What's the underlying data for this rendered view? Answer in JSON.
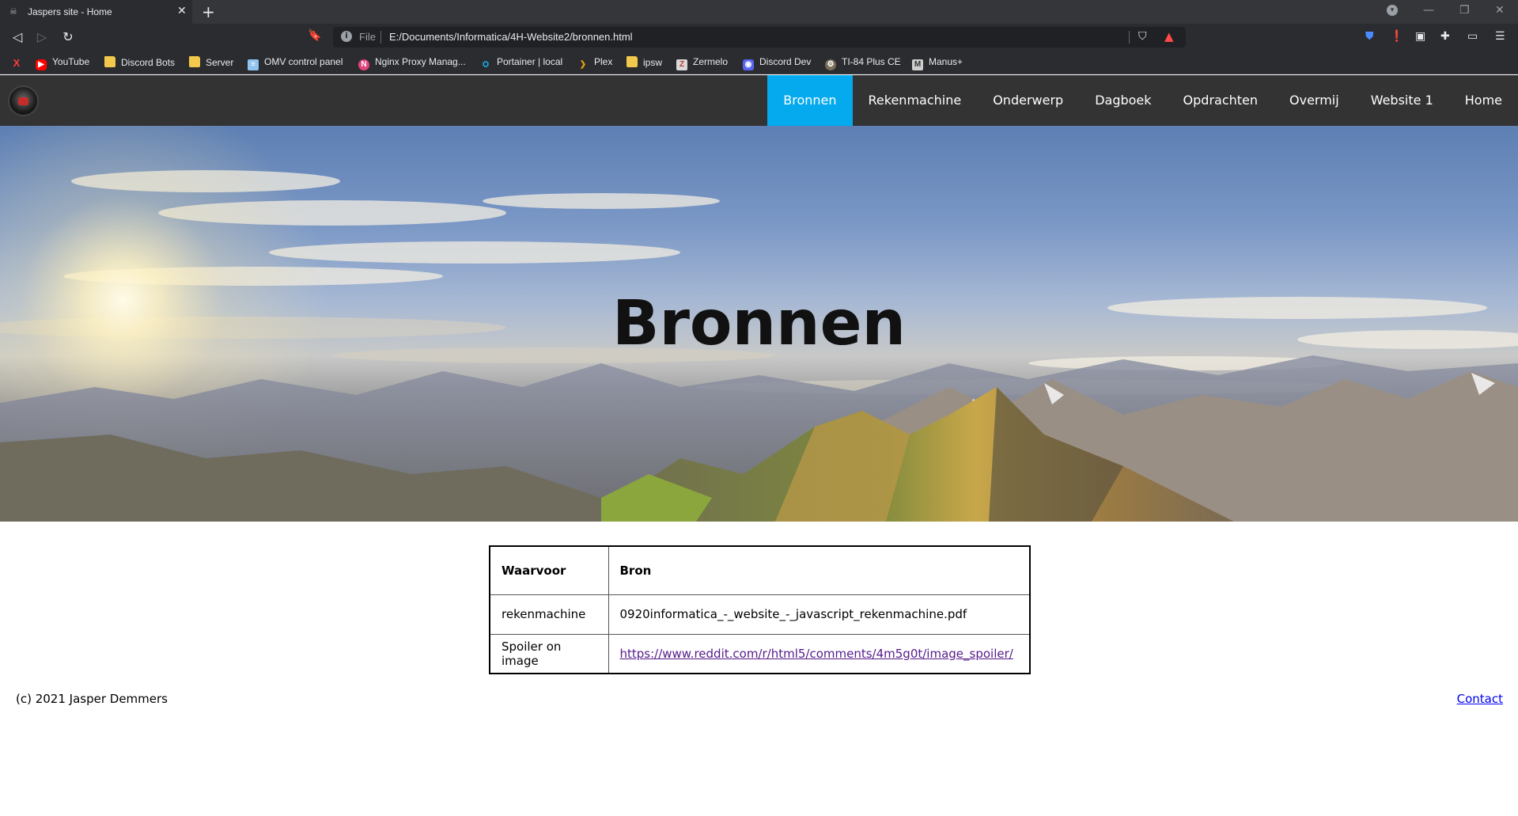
{
  "browser": {
    "tab_title": "Jaspers site - Home",
    "address_scheme": "File",
    "address_url": "E:/Documents/Informatica/4H-Website2/bronnen.html",
    "bookmarks": [
      {
        "label": "",
        "icon": "x-icon"
      },
      {
        "label": "YouTube",
        "icon": "youtube-icon"
      },
      {
        "label": "Discord Bots",
        "icon": "folder-icon"
      },
      {
        "label": "Server",
        "icon": "folder-icon"
      },
      {
        "label": "OMV control panel",
        "icon": "omv-icon"
      },
      {
        "label": "Nginx Proxy Manag...",
        "icon": "nginx-icon"
      },
      {
        "label": "Portainer | local",
        "icon": "portainer-icon"
      },
      {
        "label": "Plex",
        "icon": "plex-icon"
      },
      {
        "label": "ipsw",
        "icon": "folder-icon"
      },
      {
        "label": "Zermelo",
        "icon": "zermelo-icon"
      },
      {
        "label": "Discord Dev",
        "icon": "discord-icon"
      },
      {
        "label": "TI-84 Plus CE",
        "icon": "ti84-icon"
      },
      {
        "label": "Manus+",
        "icon": "manus-icon"
      }
    ]
  },
  "nav": {
    "items": [
      {
        "label": "Bronnen",
        "active": true
      },
      {
        "label": "Rekenmachine",
        "active": false
      },
      {
        "label": "Onderwerp",
        "active": false
      },
      {
        "label": "Dagboek",
        "active": false
      },
      {
        "label": "Opdrachten",
        "active": false
      },
      {
        "label": "Overmij",
        "active": false
      },
      {
        "label": "Website 1",
        "active": false
      },
      {
        "label": "Home",
        "active": false
      }
    ],
    "active_color": "#04AAED"
  },
  "hero": {
    "title": "Bronnen"
  },
  "sources_table": {
    "headers": [
      "Waarvoor",
      "Bron"
    ],
    "rows": [
      {
        "purpose": "rekenmachine",
        "source": "0920informatica_-_website_-_javascript_rekenmachine.pdf",
        "is_link": false
      },
      {
        "purpose": "Spoiler on image",
        "source": "https://www.reddit.com/r/html5/comments/4m5g0t/image_spoiler/",
        "is_link": true
      }
    ]
  },
  "footer": {
    "copyright": "(c) 2021 Jasper Demmers",
    "contact_label": "Contact"
  }
}
